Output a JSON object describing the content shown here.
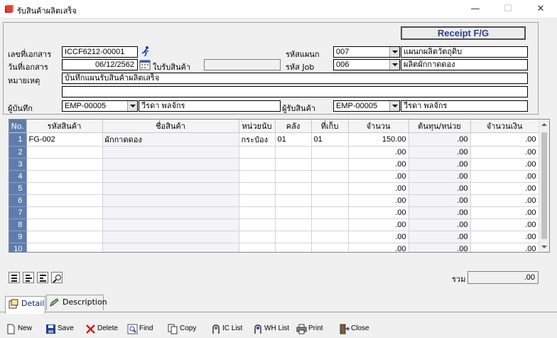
{
  "window": {
    "title": "รับสินค้าผลิตเสร็จ"
  },
  "header": {
    "receipt_title": "Receipt F/G",
    "doc_no_label": "เลขที่เอกสาร",
    "doc_no": "ICCF6212-00001",
    "doc_date_label": "วันที่เอกสาร",
    "doc_date": "06/12/2562",
    "receive_no_label": "ใบรับสินค้า",
    "receive_no": "",
    "dept_label": "รหัสแผนก",
    "dept_code": "007",
    "dept_name": "แผนกผลิตวัตถุดิบ",
    "job_label": "รหัส Job",
    "job_code": "006",
    "job_name": "ผลิตผักกาดดอง",
    "remark_label": "หมายเหตุ",
    "remark1": "บันทึกแผนรับสินค้าผลิตเสร็จ",
    "remark2": "",
    "recorder_label": "ผู้บันทึก",
    "recorder_code": "EMP-00005",
    "recorder_name": "วีรดา  พลจักร",
    "receiver_label": "ผู้รับสินค้า",
    "receiver_code": "EMP-00005",
    "receiver_name": "วีรดา  พลจักร"
  },
  "grid": {
    "columns": [
      "No.",
      "รหัสสินค้า",
      "ชื่อสินค้า",
      "หน่วยนับ",
      "คลัง",
      "ที่เก็บ",
      "จำนวน",
      "ต้นทุน/หน่วย",
      "จำนวนเงิน"
    ],
    "rows": [
      {
        "no": "1",
        "code": "FG-002",
        "name": "ผักกาดดอง",
        "unit": "กระป๋อง",
        "wh": "01",
        "loc": "01",
        "qty": "150.00",
        "cost": ".00",
        "amount": ".00"
      },
      {
        "no": "2",
        "code": "",
        "name": "",
        "unit": "",
        "wh": "",
        "loc": "",
        "qty": ".00",
        "cost": ".00",
        "amount": ".00"
      },
      {
        "no": "3",
        "code": "",
        "name": "",
        "unit": "",
        "wh": "",
        "loc": "",
        "qty": ".00",
        "cost": ".00",
        "amount": ".00"
      },
      {
        "no": "4",
        "code": "",
        "name": "",
        "unit": "",
        "wh": "",
        "loc": "",
        "qty": ".00",
        "cost": ".00",
        "amount": ".00"
      },
      {
        "no": "5",
        "code": "",
        "name": "",
        "unit": "",
        "wh": "",
        "loc": "",
        "qty": ".00",
        "cost": ".00",
        "amount": ".00"
      },
      {
        "no": "6",
        "code": "",
        "name": "",
        "unit": "",
        "wh": "",
        "loc": "",
        "qty": ".00",
        "cost": ".00",
        "amount": ".00"
      },
      {
        "no": "7",
        "code": "",
        "name": "",
        "unit": "",
        "wh": "",
        "loc": "",
        "qty": ".00",
        "cost": ".00",
        "amount": ".00"
      },
      {
        "no": "8",
        "code": "",
        "name": "",
        "unit": "",
        "wh": "",
        "loc": "",
        "qty": ".00",
        "cost": ".00",
        "amount": ".00"
      },
      {
        "no": "9",
        "code": "",
        "name": "",
        "unit": "",
        "wh": "",
        "loc": "",
        "qty": ".00",
        "cost": ".00",
        "amount": ".00"
      },
      {
        "no": "10",
        "code": "",
        "name": "",
        "unit": "",
        "wh": "",
        "loc": "",
        "qty": ".00",
        "cost": ".00",
        "amount": ".00"
      }
    ]
  },
  "total": {
    "label": "รวม",
    "value": ".00"
  },
  "tabs": [
    {
      "label": "Detail"
    },
    {
      "label": "Description"
    }
  ],
  "toolbar": {
    "new": "New",
    "save": "Save",
    "delete": "Delete",
    "find": "Find",
    "copy": "Copy",
    "ic_list": "IC List",
    "wh_list": "WH List",
    "print": "Print",
    "close": "Close"
  },
  "colors": {
    "accent_blue": "#2a3e8c",
    "row_header": "#5f7dac",
    "app_icon_red": "#cc1f1f"
  }
}
